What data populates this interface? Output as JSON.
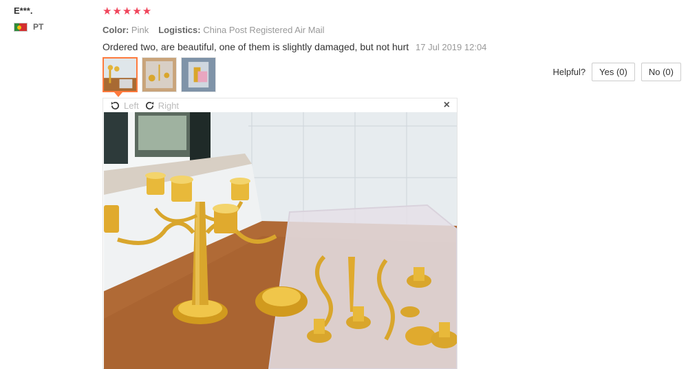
{
  "reviewer": {
    "name": "E***.",
    "country": "PT"
  },
  "review": {
    "stars": "★★★★★",
    "color_label": "Color:",
    "color_value": "Pink",
    "logistics_label": "Logistics:",
    "logistics_value": "China Post Registered Air Mail",
    "text": "Ordered two, are beautiful, one of them is slightly damaged, but not hurt",
    "date": "17 Jul 2019 12:04"
  },
  "helpful": {
    "label": "Helpful?",
    "yes": "Yes (0)",
    "no": "No (0)"
  },
  "viewer": {
    "left_label": "Left",
    "right_label": "Right",
    "close": "×"
  },
  "colors": {
    "star": "#f0455b",
    "active_border": "#ff7a3d"
  }
}
